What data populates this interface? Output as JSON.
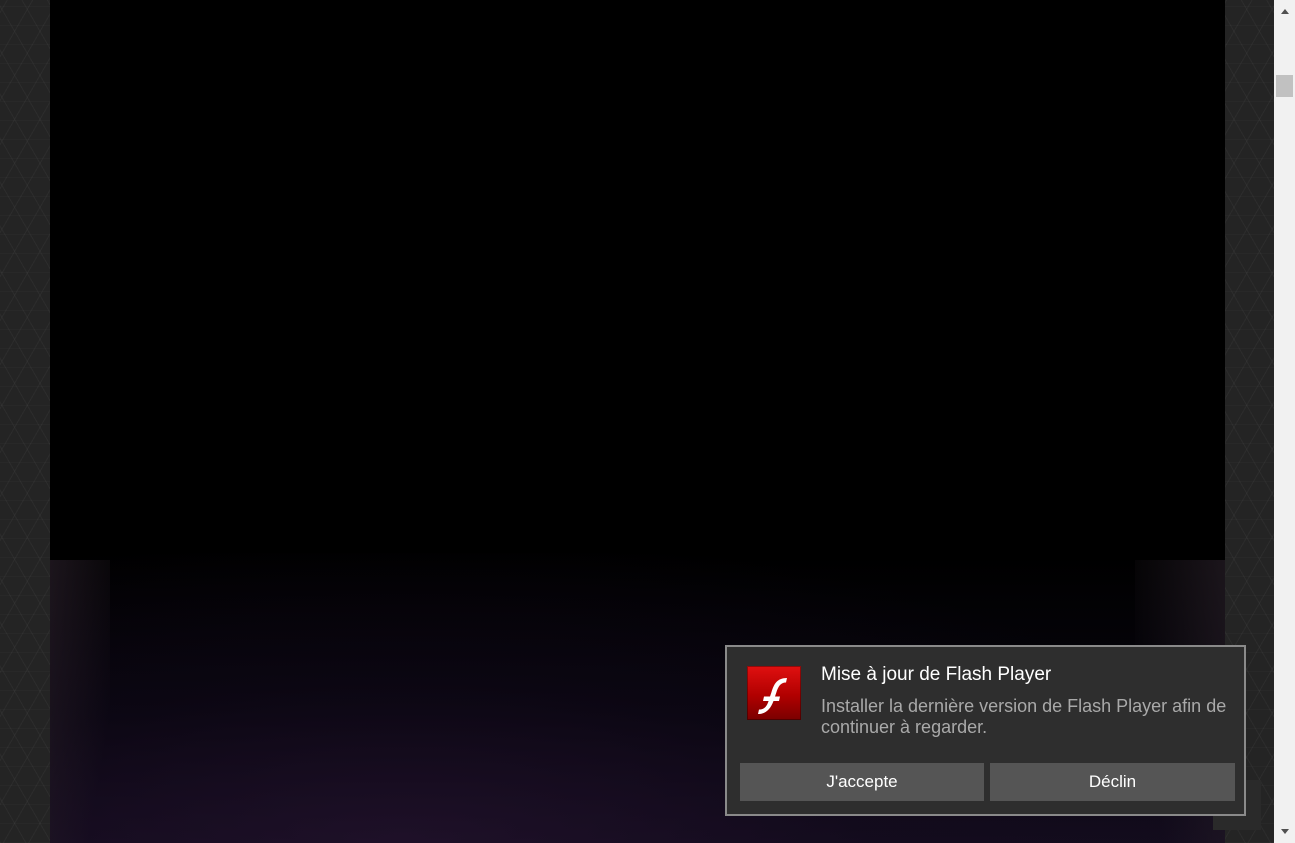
{
  "popup": {
    "title": "Mise à jour de Flash Player",
    "message": "Installer la dernière version de Flash Player afin de continuer à regarder.",
    "icon": "flash-player-icon",
    "accept_label": "J'accepte",
    "decline_label": "Déclin"
  },
  "colors": {
    "popup_background": "#2e2e2e",
    "popup_border": "#8a8a8a",
    "button_background": "#555555",
    "flash_red": "#d00000",
    "video_background": "#000000"
  },
  "scrollbar": {
    "up_icon": "scroll-up-arrow-icon",
    "down_icon": "scroll-down-arrow-icon"
  }
}
